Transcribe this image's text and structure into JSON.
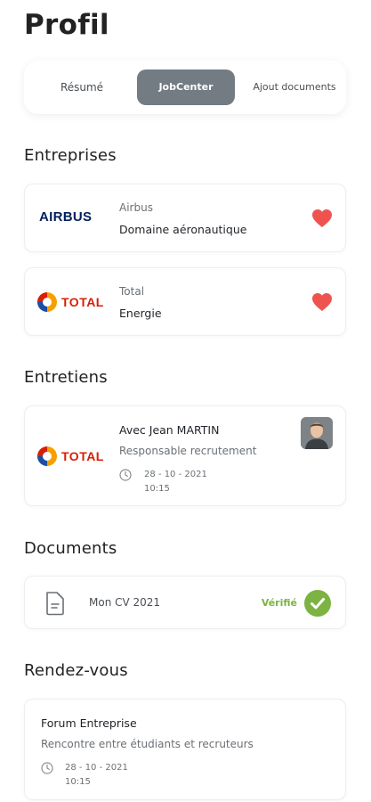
{
  "page": {
    "title": "Profil"
  },
  "tabs": [
    {
      "label": "Résumé"
    },
    {
      "label": "JobCenter"
    },
    {
      "label": "Ajout documents"
    }
  ],
  "sections": {
    "companies": "Entreprises",
    "interviews": "Entretiens",
    "documents": "Documents",
    "appointments": "Rendez-vous"
  },
  "companies": [
    {
      "logo_text": "AIRBUS",
      "name": "Airbus",
      "domain": "Domaine aéronautique",
      "favorite_icon": "heart-icon"
    },
    {
      "logo_text": "TOTAL",
      "name": "Total",
      "domain": "Energie",
      "favorite_icon": "heart-icon"
    }
  ],
  "interview": {
    "logo_text": "TOTAL",
    "with": "Avec Jean MARTIN",
    "role": "Responsable recrutement",
    "date": "28 - 10 - 2021",
    "time": "10:15"
  },
  "document": {
    "name": "Mon CV 2021",
    "status": "Vérifié",
    "status_icon": "check-icon"
  },
  "appointment": {
    "title": "Forum Entreprise",
    "description": "Rencontre entre étudiants et recruteurs",
    "date": "28 - 10 - 2021",
    "time": "10:15"
  },
  "colors": {
    "heart": "#ef5350",
    "active_tab": "#737b83",
    "verified": "#7cb342",
    "airbus_blue": "#00205b",
    "total_red": "#d81e05"
  }
}
